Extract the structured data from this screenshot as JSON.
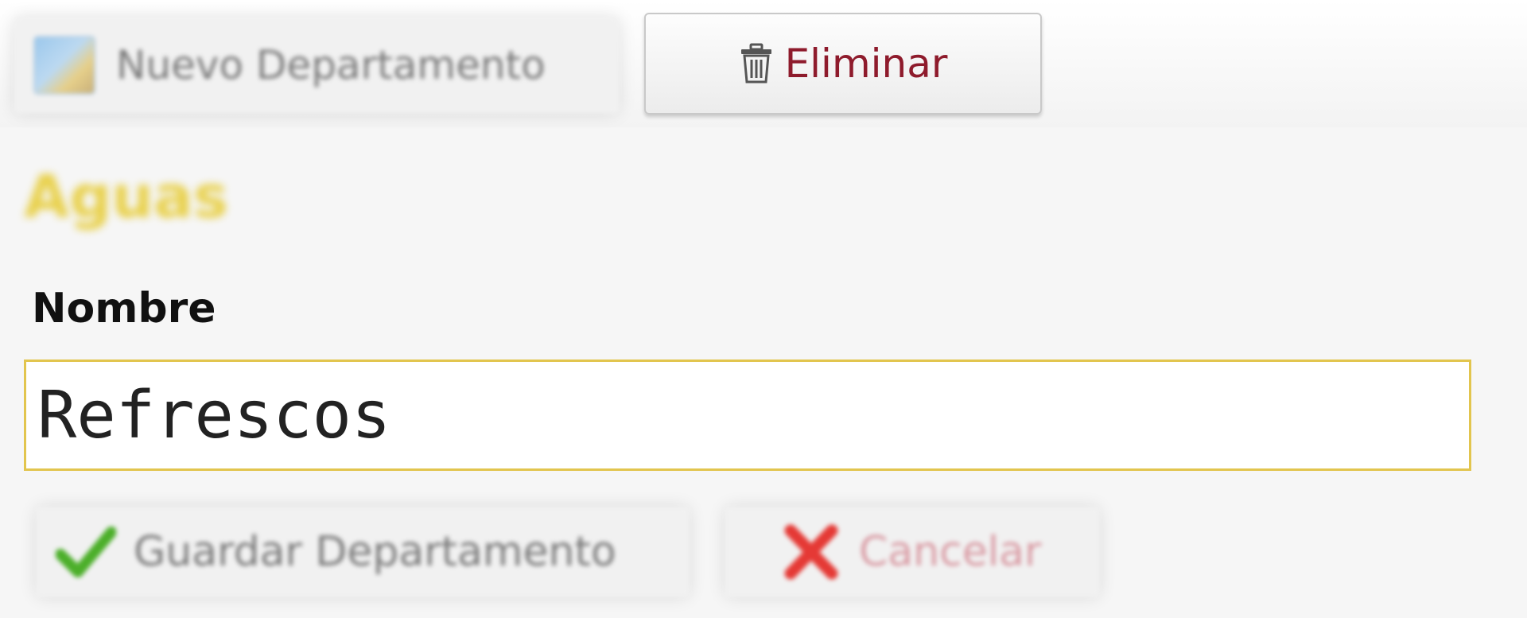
{
  "toolbar": {
    "new_department_label": "Nuevo Departamento",
    "new_department_icon": "department-icon",
    "delete_label": "Eliminar",
    "delete_icon": "trash-icon",
    "delete_color": "#8e1b2c"
  },
  "section": {
    "heading": "Aguas",
    "heading_color": "#e8d04a"
  },
  "form": {
    "name_label": "Nombre",
    "name_value": "Refrescos",
    "input_border_color": "#e2c54e"
  },
  "actions": {
    "save_label": "Guardar Departamento",
    "save_icon": "checkmark-icon",
    "save_icon_color": "#4caf2a",
    "cancel_label": "Cancelar",
    "cancel_icon": "x-icon",
    "cancel_icon_color": "#e53935"
  }
}
